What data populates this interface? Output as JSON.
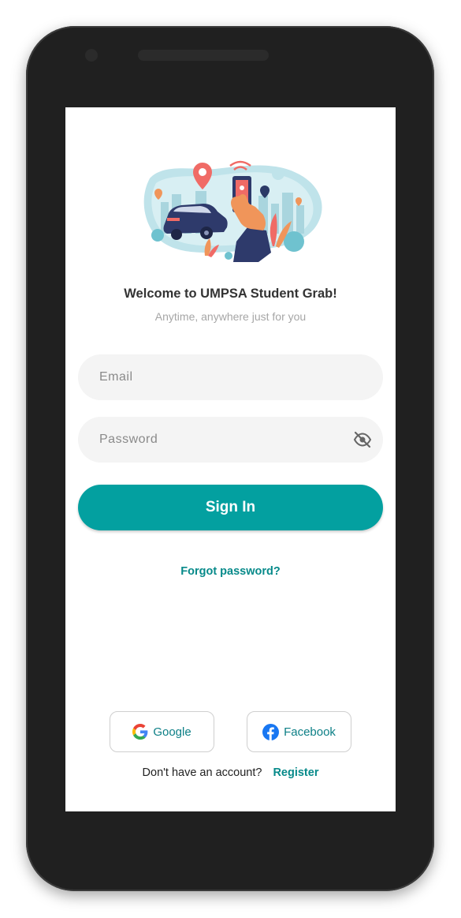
{
  "login": {
    "title": "Welcome to UMPSA Student Grab!",
    "subtitle": "Anytime, anywhere just for you",
    "email_placeholder": "Email",
    "password_placeholder": "Password",
    "signin_label": "Sign In",
    "forgot_label": "Forgot password?",
    "google_label": "Google",
    "facebook_label": "Facebook",
    "no_account_text": "Don't have an account?",
    "register_label": "Register"
  },
  "icons": {
    "password_toggle": "eye-off-icon",
    "google": "google-icon",
    "facebook": "facebook-icon"
  },
  "colors": {
    "accent": "#03a0a0",
    "link": "#078a8a",
    "field_bg": "#f4f4f4",
    "phone_frame": "#202020"
  }
}
